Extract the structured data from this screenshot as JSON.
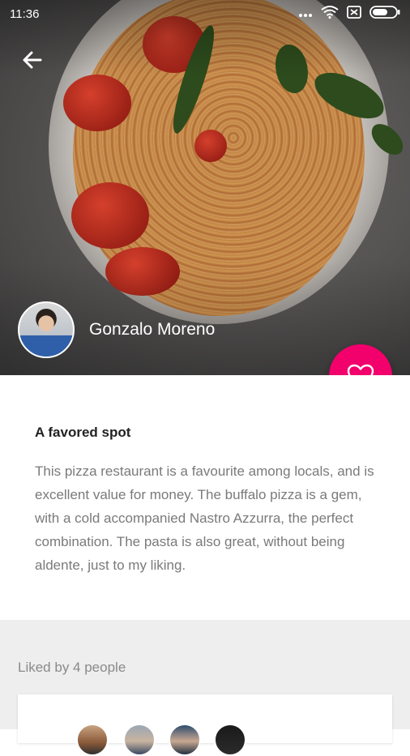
{
  "status_bar": {
    "time": "11:36",
    "icons": [
      "dots-icon",
      "wifi-icon",
      "sim-icon",
      "battery-icon"
    ]
  },
  "header": {
    "back_icon": "arrow-back-icon"
  },
  "author": {
    "name": "Gonzalo Moreno"
  },
  "fab": {
    "icon": "heart-outline-icon",
    "color": "#f2006b"
  },
  "review": {
    "title": "A favored spot",
    "body": " This pizza restaurant is a favourite among locals, and is excellent value for money. The buffalo pizza is a gem, with a cold accompanied Nastro Azzurra, the perfect combination. The pasta is also great, without being aldente, just to my liking."
  },
  "likes": {
    "label": "Liked by 4 people",
    "avatars": [
      "avatar-1",
      "avatar-2",
      "avatar-3",
      "avatar-4"
    ]
  }
}
